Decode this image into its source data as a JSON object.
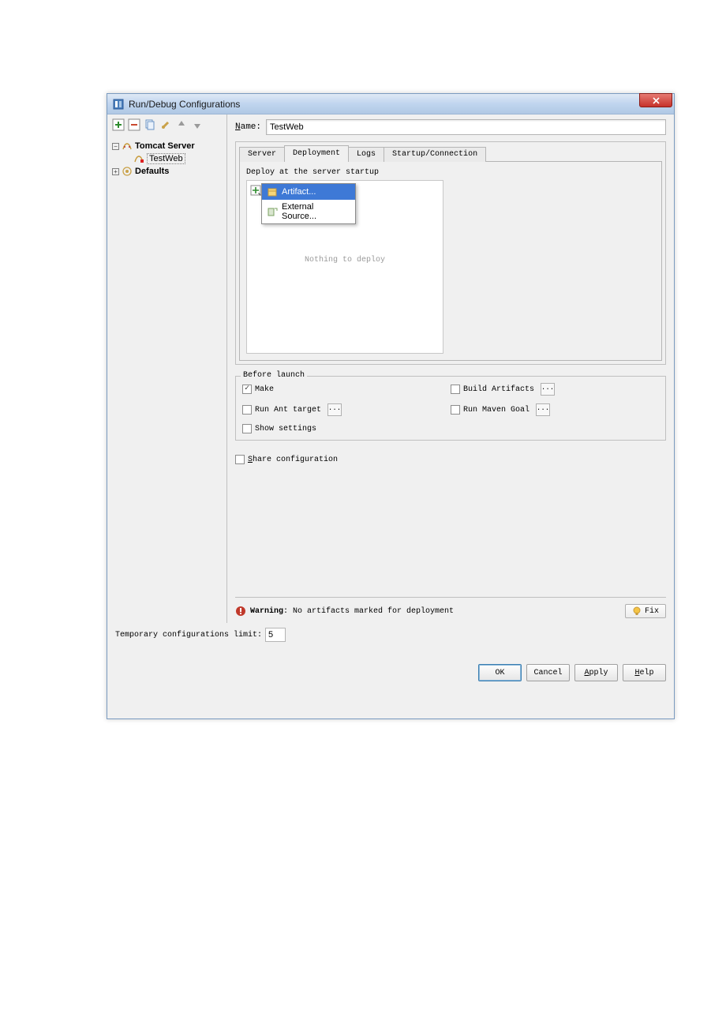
{
  "window": {
    "title": "Run/Debug Configurations"
  },
  "sidebar": {
    "tomcat_label": "Tomcat Server",
    "testweb_label": "TestWeb",
    "defaults_label": "Defaults"
  },
  "name_field": {
    "label_letter": "N",
    "label_rest": "ame:",
    "value": "TestWeb"
  },
  "tabs": {
    "server": "Server",
    "deployment": "Deployment",
    "logs": "Logs",
    "startup": "Startup/Connection"
  },
  "deployment": {
    "caption": "Deploy at the server startup",
    "artifact": "Artifact...",
    "external": "External Source...",
    "placeholder": "Nothing to deploy"
  },
  "before_launch": {
    "legend": "Before launch",
    "make": "Make",
    "build_artifacts": "Build Artifacts",
    "run_ant": "Run Ant target",
    "run_maven": "Run Maven Goal",
    "show_settings": "Show settings"
  },
  "share": {
    "label_letter": "S",
    "label_rest": "hare configuration"
  },
  "warning": {
    "label": "Warning",
    "text": ": No artifacts marked for deployment",
    "fix": "Fix"
  },
  "temp_limit": {
    "label": "Temporary configurations limit:",
    "value": "5"
  },
  "buttons": {
    "ok": "OK",
    "cancel": "Cancel",
    "apply_letter": "A",
    "apply_rest": "pply",
    "help_letter": "H",
    "help_rest": "elp"
  }
}
